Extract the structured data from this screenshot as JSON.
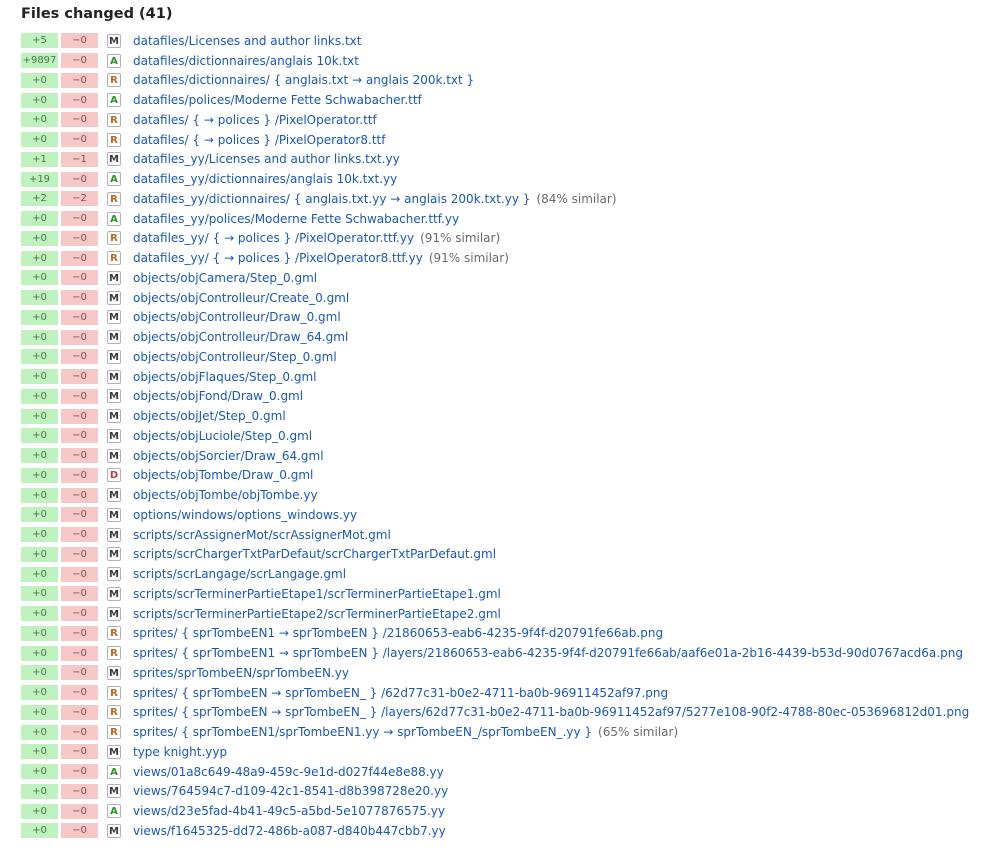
{
  "title": "Files changed (41)",
  "colors": {
    "additions_bg": "#bff2bf",
    "deletions_bg": "#f7c8c8",
    "link": "#1b58b5",
    "status_added": "#2f8f2f",
    "status_renamed": "#b46b26",
    "status_deleted": "#c23a3a"
  },
  "files": [
    {
      "add": "+5",
      "del": "−0",
      "status": "M",
      "path": "datafiles/Licenses and author links.txt",
      "note": ""
    },
    {
      "add": "+9897",
      "del": "−0",
      "status": "A",
      "path": "datafiles/dictionnaires/anglais 10k.txt",
      "note": ""
    },
    {
      "add": "+0",
      "del": "−0",
      "status": "R",
      "path": "datafiles/dictionnaires/ { anglais.txt → anglais 200k.txt }",
      "note": ""
    },
    {
      "add": "+0",
      "del": "−0",
      "status": "A",
      "path": "datafiles/polices/Moderne Fette Schwabacher.ttf",
      "note": ""
    },
    {
      "add": "+0",
      "del": "−0",
      "status": "R",
      "path": "datafiles/ { → polices } /PixelOperator.ttf",
      "note": ""
    },
    {
      "add": "+0",
      "del": "−0",
      "status": "R",
      "path": "datafiles/ { → polices } /PixelOperator8.ttf",
      "note": ""
    },
    {
      "add": "+1",
      "del": "−1",
      "status": "M",
      "path": "datafiles_yy/Licenses and author links.txt.yy",
      "note": ""
    },
    {
      "add": "+19",
      "del": "−0",
      "status": "A",
      "path": "datafiles_yy/dictionnaires/anglais 10k.txt.yy",
      "note": ""
    },
    {
      "add": "+2",
      "del": "−2",
      "status": "R",
      "path": "datafiles_yy/dictionnaires/ { anglais.txt.yy → anglais 200k.txt.yy }",
      "note": "(84% similar)"
    },
    {
      "add": "+0",
      "del": "−0",
      "status": "A",
      "path": "datafiles_yy/polices/Moderne Fette Schwabacher.ttf.yy",
      "note": ""
    },
    {
      "add": "+0",
      "del": "−0",
      "status": "R",
      "path": "datafiles_yy/ { → polices } /PixelOperator.ttf.yy",
      "note": "(91% similar)"
    },
    {
      "add": "+0",
      "del": "−0",
      "status": "R",
      "path": "datafiles_yy/ { → polices } /PixelOperator8.ttf.yy",
      "note": "(91% similar)"
    },
    {
      "add": "+0",
      "del": "−0",
      "status": "M",
      "path": "objects/objCamera/Step_0.gml",
      "note": ""
    },
    {
      "add": "+0",
      "del": "−0",
      "status": "M",
      "path": "objects/objControlleur/Create_0.gml",
      "note": ""
    },
    {
      "add": "+0",
      "del": "−0",
      "status": "M",
      "path": "objects/objControlleur/Draw_0.gml",
      "note": ""
    },
    {
      "add": "+0",
      "del": "−0",
      "status": "M",
      "path": "objects/objControlleur/Draw_64.gml",
      "note": ""
    },
    {
      "add": "+0",
      "del": "−0",
      "status": "M",
      "path": "objects/objControlleur/Step_0.gml",
      "note": ""
    },
    {
      "add": "+0",
      "del": "−0",
      "status": "M",
      "path": "objects/objFlaques/Step_0.gml",
      "note": ""
    },
    {
      "add": "+0",
      "del": "−0",
      "status": "M",
      "path": "objects/objFond/Draw_0.gml",
      "note": ""
    },
    {
      "add": "+0",
      "del": "−0",
      "status": "M",
      "path": "objects/objJet/Step_0.gml",
      "note": ""
    },
    {
      "add": "+0",
      "del": "−0",
      "status": "M",
      "path": "objects/objLuciole/Step_0.gml",
      "note": ""
    },
    {
      "add": "+0",
      "del": "−0",
      "status": "M",
      "path": "objects/objSorcier/Draw_64.gml",
      "note": ""
    },
    {
      "add": "+0",
      "del": "−0",
      "status": "D",
      "path": "objects/objTombe/Draw_0.gml",
      "note": ""
    },
    {
      "add": "+0",
      "del": "−0",
      "status": "M",
      "path": "objects/objTombe/objTombe.yy",
      "note": ""
    },
    {
      "add": "+0",
      "del": "−0",
      "status": "M",
      "path": "options/windows/options_windows.yy",
      "note": ""
    },
    {
      "add": "+0",
      "del": "−0",
      "status": "M",
      "path": "scripts/scrAssignerMot/scrAssignerMot.gml",
      "note": ""
    },
    {
      "add": "+0",
      "del": "−0",
      "status": "M",
      "path": "scripts/scrChargerTxtParDefaut/scrChargerTxtParDefaut.gml",
      "note": ""
    },
    {
      "add": "+0",
      "del": "−0",
      "status": "M",
      "path": "scripts/scrLangage/scrLangage.gml",
      "note": ""
    },
    {
      "add": "+0",
      "del": "−0",
      "status": "M",
      "path": "scripts/scrTerminerPartieEtape1/scrTerminerPartieEtape1.gml",
      "note": ""
    },
    {
      "add": "+0",
      "del": "−0",
      "status": "M",
      "path": "scripts/scrTerminerPartieEtape2/scrTerminerPartieEtape2.gml",
      "note": ""
    },
    {
      "add": "+0",
      "del": "−0",
      "status": "R",
      "path": "sprites/ { sprTombeEN1 → sprTombeEN } /21860653-eab6-4235-9f4f-d20791fe66ab.png",
      "note": ""
    },
    {
      "add": "+0",
      "del": "−0",
      "status": "R",
      "path": "sprites/ { sprTombeEN1 → sprTombeEN } /layers/21860653-eab6-4235-9f4f-d20791fe66ab/aaf6e01a-2b16-4439-b53d-90d0767acd6a.png",
      "note": ""
    },
    {
      "add": "+0",
      "del": "−0",
      "status": "M",
      "path": "sprites/sprTombeEN/sprTombeEN.yy",
      "note": ""
    },
    {
      "add": "+0",
      "del": "−0",
      "status": "R",
      "path": "sprites/ { sprTombeEN → sprTombeEN_ } /62d77c31-b0e2-4711-ba0b-96911452af97.png",
      "note": ""
    },
    {
      "add": "+0",
      "del": "−0",
      "status": "R",
      "path": "sprites/ { sprTombeEN → sprTombeEN_ } /layers/62d77c31-b0e2-4711-ba0b-96911452af97/5277e108-90f2-4788-80ec-053696812d01.png",
      "note": ""
    },
    {
      "add": "+0",
      "del": "−0",
      "status": "R",
      "path": "sprites/ { sprTombeEN1/sprTombeEN1.yy → sprTombeEN_/sprTombeEN_.yy }",
      "note": "(65% similar)"
    },
    {
      "add": "+0",
      "del": "−0",
      "status": "M",
      "path": "type knight.yyp",
      "note": ""
    },
    {
      "add": "+0",
      "del": "−0",
      "status": "A",
      "path": "views/01a8c649-48a9-459c-9e1d-d027f44e8e88.yy",
      "note": ""
    },
    {
      "add": "+0",
      "del": "−0",
      "status": "M",
      "path": "views/764594c7-d109-42c1-8541-d8b398728e20.yy",
      "note": ""
    },
    {
      "add": "+0",
      "del": "−0",
      "status": "A",
      "path": "views/d23e5fad-4b41-49c5-a5bd-5e1077876575.yy",
      "note": ""
    },
    {
      "add": "+0",
      "del": "−0",
      "status": "M",
      "path": "views/f1645325-dd72-486b-a087-d840b447cbb7.yy",
      "note": ""
    }
  ]
}
